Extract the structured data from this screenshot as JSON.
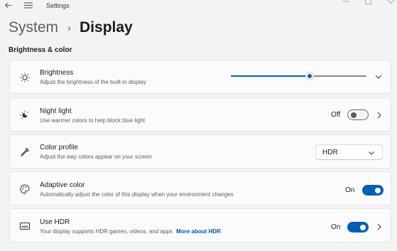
{
  "window": {
    "app_title": "Settings"
  },
  "breadcrumb": {
    "parent": "System",
    "separator": "›",
    "current": "Display"
  },
  "section": {
    "title": "Brightness & color"
  },
  "cards": {
    "brightness": {
      "title": "Brightness",
      "description": "Adjust the brightness of the built-in display",
      "level": 0.58
    },
    "night_light": {
      "title": "Night light",
      "description": "Use warmer colors to help block blue light",
      "state_label": "Off",
      "enabled": false
    },
    "color_profile": {
      "title": "Color profile",
      "description": "Adjust the way colors appear on your screen",
      "selected": "HDR"
    },
    "adaptive_color": {
      "title": "Adaptive color",
      "description": "Automatically adjust the color of this display when your environment changes",
      "state_label": "On",
      "enabled": true
    },
    "use_hdr": {
      "title": "Use HDR",
      "description": "Your display supports HDR games, videos, and apps",
      "link": "More about HDR",
      "state_label": "On",
      "enabled": true
    }
  },
  "colors": {
    "accent": "#005fb8",
    "link": "#0058a8",
    "background": "#f3f3f3",
    "card": "#fbfbfb"
  },
  "icons": {
    "back": "back-arrow-icon",
    "menu": "hamburger-menu-icon",
    "brightness": "sun-icon",
    "night_light": "night-light-icon",
    "color_profile": "eyedropper-icon",
    "adaptive_color": "palette-icon",
    "use_hdr": "hdr-icon"
  }
}
